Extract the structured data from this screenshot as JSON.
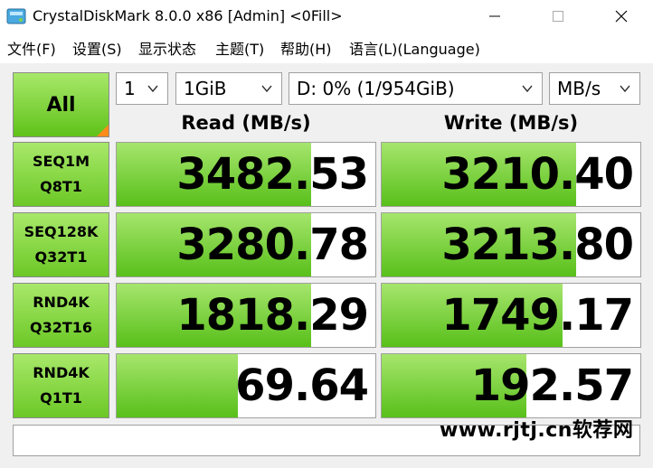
{
  "window": {
    "title": "CrystalDiskMark 8.0.0 x86 [Admin] <0Fill>",
    "app_icon": "crystaldiskmark-disk-icon",
    "controls": [
      "minimize-icon",
      "maximize-icon",
      "close-icon"
    ]
  },
  "menu": {
    "items": [
      "文件(F)",
      "设置(S)",
      "显示状态",
      "主题(T)",
      "帮助(H)",
      "语言(L)(Language)"
    ]
  },
  "toolbar": {
    "all_label": "All",
    "count_select": "1",
    "size_select": "1GiB",
    "drive_select": "D: 0% (1/954GiB)",
    "unit_select": "MB/s"
  },
  "columns": {
    "read": "Read (MB/s)",
    "write": "Write (MB/s)"
  },
  "rows": [
    {
      "line1": "SEQ1M",
      "line2": "Q8T1",
      "read": "3482.53",
      "write": "3210.40",
      "read_fill": 0.75,
      "write_fill": 0.75
    },
    {
      "line1": "SEQ128K",
      "line2": "Q32T1",
      "read": "3280.78",
      "write": "3213.80",
      "read_fill": 0.75,
      "write_fill": 0.75
    },
    {
      "line1": "RND4K",
      "line2": "Q32T16",
      "read": "1818.29",
      "write": "1749.17",
      "read_fill": 0.75,
      "write_fill": 0.7
    },
    {
      "line1": "RND4K",
      "line2": "Q1T1",
      "read": "69.64",
      "write": "192.57",
      "read_fill": 0.47,
      "write_fill": 0.56
    }
  ],
  "status_text": "",
  "watermark": "www.rjtj.cn软荐网",
  "colors": {
    "bar_light": "#a6e56d",
    "bar_dark": "#58c01a",
    "corner_accent": "#ff8a1c"
  }
}
